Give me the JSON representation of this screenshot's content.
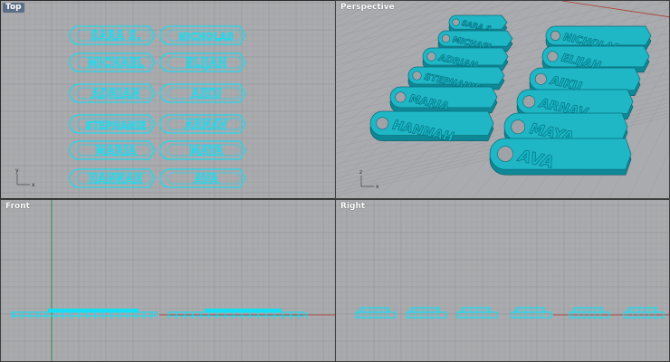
{
  "viewports": {
    "top": {
      "label": "Top"
    },
    "persp": {
      "label": "Perspective"
    },
    "front": {
      "label": "Front"
    },
    "right": {
      "label": "Right"
    }
  },
  "axes": {
    "x": "x",
    "y": "y",
    "z": "z"
  },
  "tags": {
    "left": [
      "SARA S.",
      "MICHAEL",
      "ADRIAN",
      "STEPHANIE",
      "MARIA",
      "HANNAH"
    ],
    "right": [
      "NICHOLAS",
      "ELIJAH",
      "AIKU",
      "ARNAV",
      "MAYA",
      "AVA"
    ]
  },
  "colors": {
    "viewport_bg": "#a9abae",
    "grid_minor": "#9c9ea1",
    "grid_major": "#8d8f92",
    "tag_outline": "#00e5ff",
    "tag_fill_persp": "#1fb6c6",
    "axis_x": "#b03a2e",
    "axis_y": "#2e8b3a",
    "label_active": "#5e6e86"
  }
}
